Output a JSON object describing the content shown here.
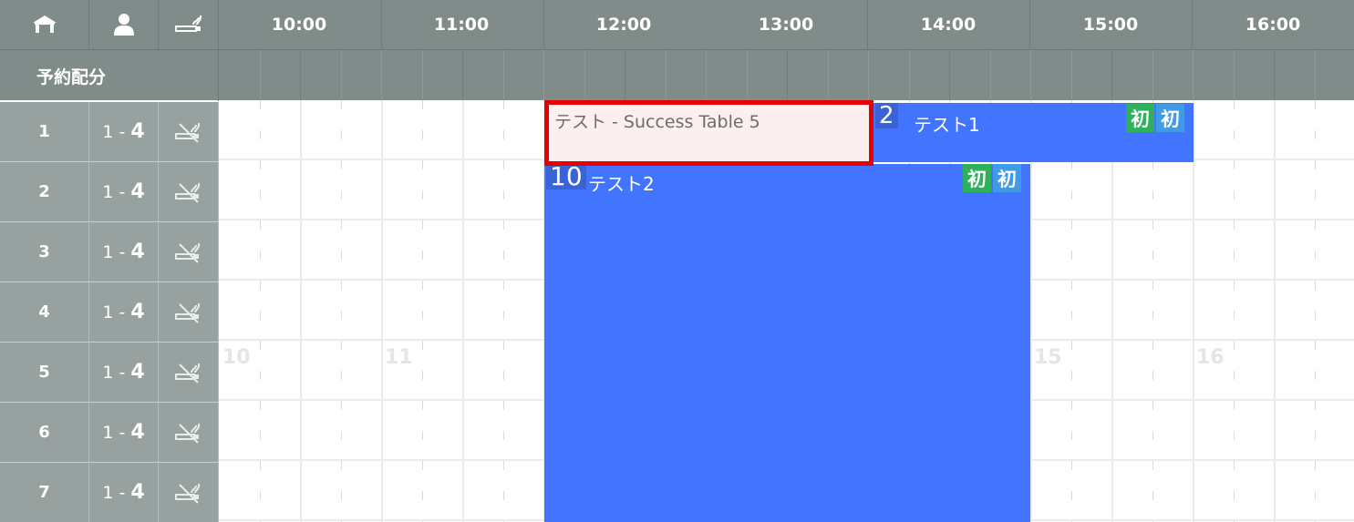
{
  "header": {
    "icons": [
      "table-icon",
      "person-icon",
      "smoking-icon"
    ],
    "times": [
      "10:00",
      "11:00",
      "12:00",
      "13:00",
      "14:00",
      "15:00",
      "16:00"
    ]
  },
  "allocation": {
    "label": "予約配分"
  },
  "rows": [
    {
      "number": "1",
      "cap_min": "1 - ",
      "cap_max": "4",
      "smoking": "no-smoking-icon"
    },
    {
      "number": "2",
      "cap_min": "1 - ",
      "cap_max": "4",
      "smoking": "no-smoking-icon"
    },
    {
      "number": "3",
      "cap_min": "1 - ",
      "cap_max": "4",
      "smoking": "no-smoking-icon"
    },
    {
      "number": "4",
      "cap_min": "1 - ",
      "cap_max": "4",
      "smoking": "no-smoking-icon"
    },
    {
      "number": "5",
      "cap_min": "1 - ",
      "cap_max": "4",
      "smoking": "no-smoking-icon"
    },
    {
      "number": "6",
      "cap_min": "1 - ",
      "cap_max": "4",
      "smoking": "no-smoking-icon"
    },
    {
      "number": "7",
      "cap_min": "1 - ",
      "cap_max": "4",
      "smoking": "no-smoking-icon"
    }
  ],
  "grid_watermarks": [
    "10",
    "11",
    "15",
    "16"
  ],
  "pending": {
    "text": "テスト - Success Table 5"
  },
  "reservations": [
    {
      "people": "2",
      "name": "テスト1",
      "badges": [
        "初",
        "初"
      ]
    },
    {
      "people": "10",
      "name": "テスト2",
      "badges": [
        "初",
        "初"
      ]
    }
  ],
  "colors": {
    "header_bg": "#7f8c8a",
    "row_bg": "#97a19f",
    "reservation": "#4374ff",
    "badge_green": "#2fb05a",
    "badge_blue": "#3f9be6",
    "highlight": "#e60000"
  }
}
